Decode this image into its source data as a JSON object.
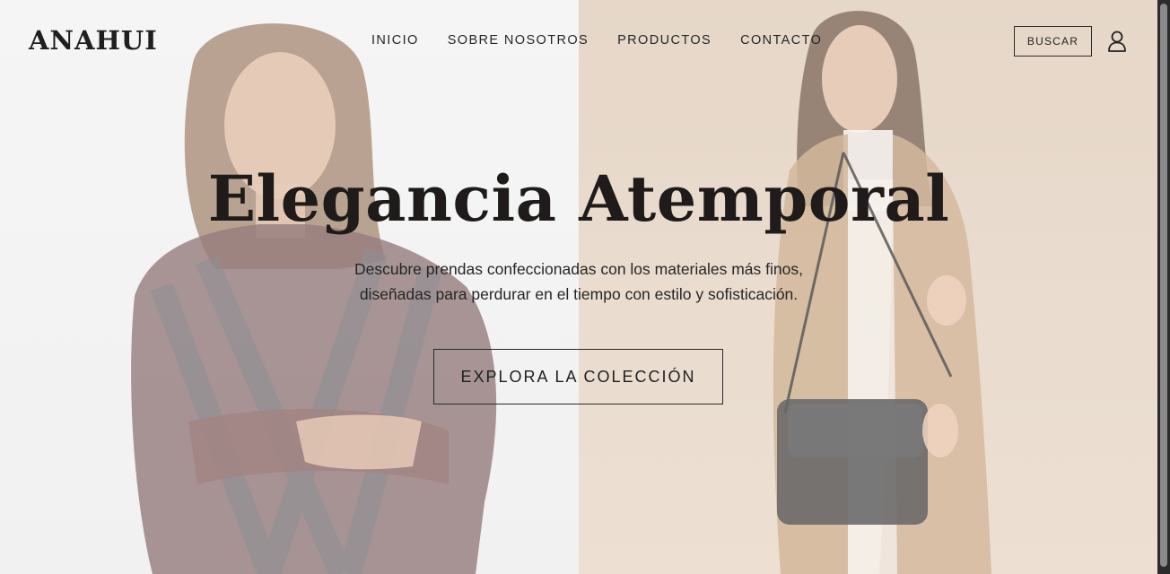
{
  "brand": {
    "logo_text": "ANAHUI"
  },
  "nav": {
    "items": [
      {
        "label": "INICIO"
      },
      {
        "label": "SOBRE NOSOTROS"
      },
      {
        "label": "PRODUCTOS"
      },
      {
        "label": "CONTACTO"
      }
    ]
  },
  "header": {
    "search_label": "BUSCAR",
    "user_icon": "user-icon"
  },
  "hero": {
    "title": "Elegancia Atemporal",
    "subtitle_line1": "Descubre prendas confeccionadas con los materiales más finos,",
    "subtitle_line2": "diseñadas para perdurar en el tiempo con estilo y sofisticación.",
    "cta_label": "EXPLORA LA COLECCIÓN"
  },
  "colors": {
    "text": "#1e1b1a",
    "left_background": "#f0f0f0",
    "right_background": "#e3d2c1",
    "scrollbar": "#2b2b2b"
  }
}
